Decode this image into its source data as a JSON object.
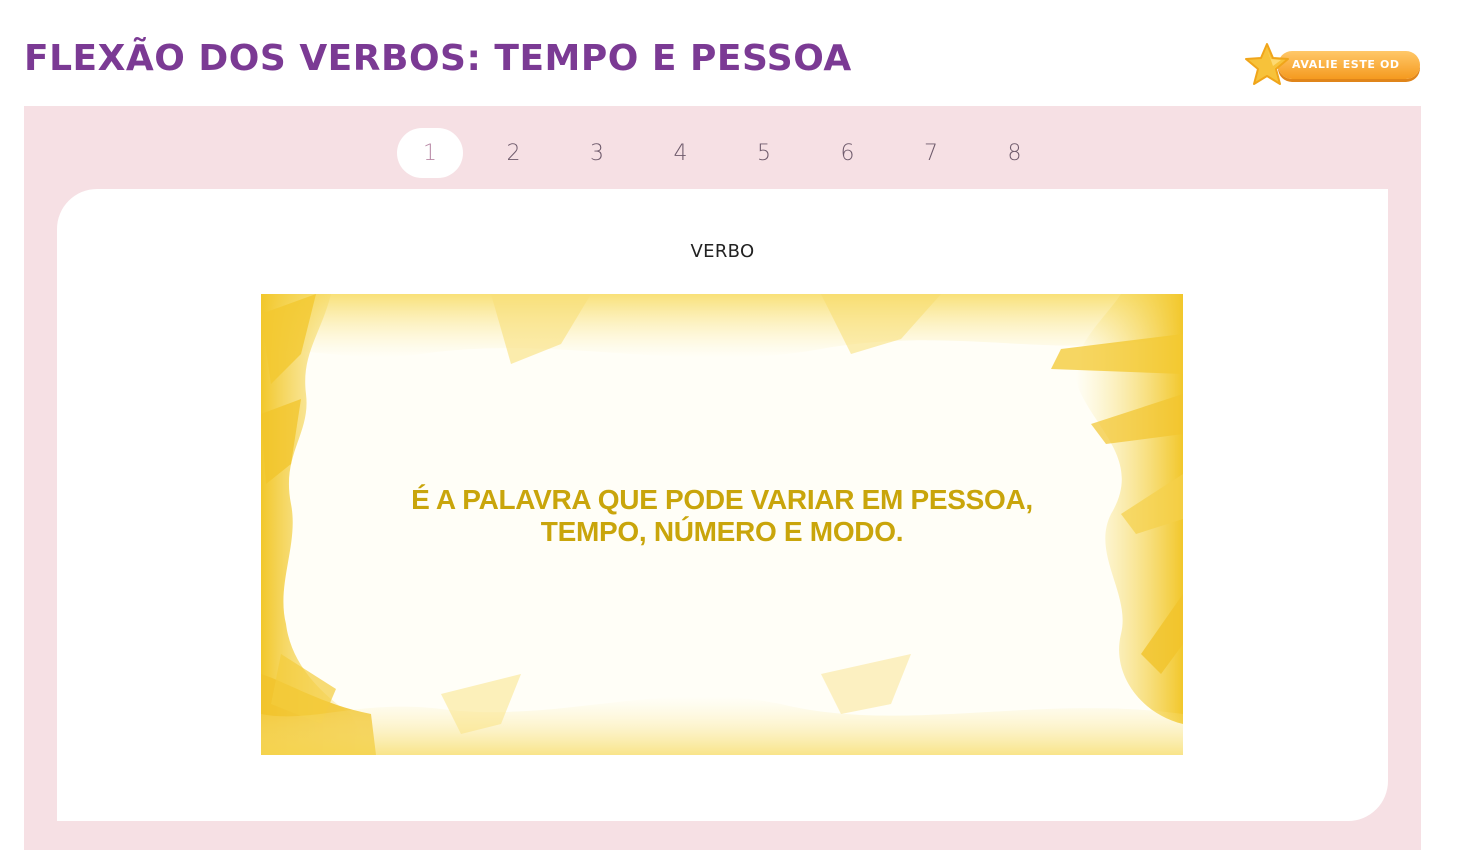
{
  "header": {
    "title": "FLEXÃO DOS VERBOS: TEMPO E PESSOA",
    "rate_button_label": "AVALIE ESTE OD",
    "rate_icon": "star-icon"
  },
  "pagination": {
    "current": 1,
    "pages": [
      "1",
      "2",
      "3",
      "4",
      "5",
      "6",
      "7",
      "8"
    ]
  },
  "content": {
    "heading": "VERBO",
    "slide_lines": [
      "É A PALAVRA QUE PODE VARIAR EM PESSOA,",
      "TEMPO, NÚMERO E MODO."
    ]
  },
  "colors": {
    "title": "#7b3a94",
    "frame_background": "#f6e0e4",
    "slide_text": "#c9a50b",
    "paint_yellow": "#f3cd3a",
    "rate_button": "#f59a1f"
  }
}
